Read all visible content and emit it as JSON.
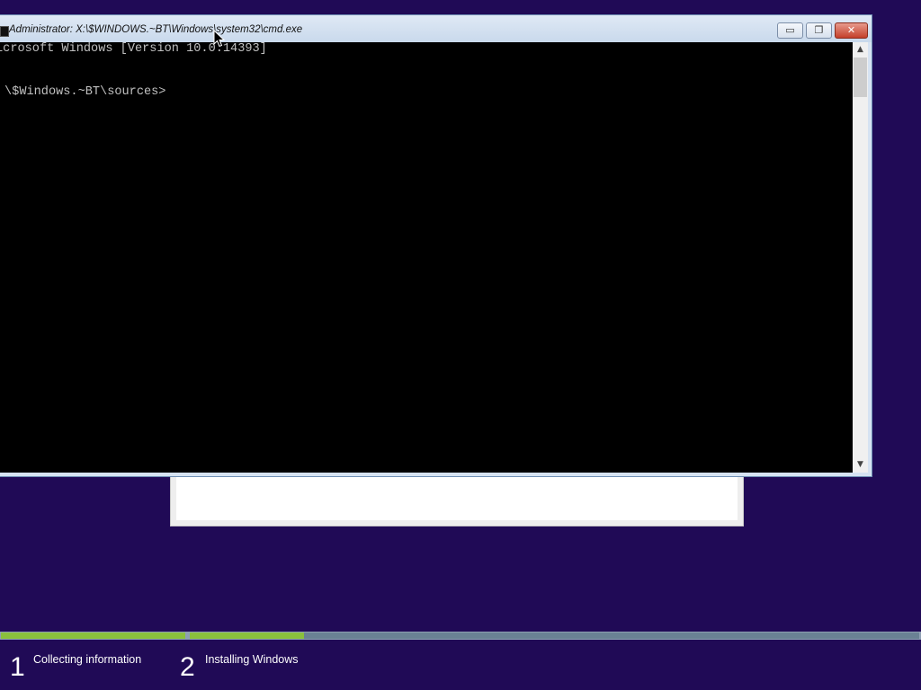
{
  "cmd_window": {
    "title": "Administrator: X:\\$WINDOWS.~BT\\Windows\\system32\\cmd.exe",
    "minimize_glyph": "▭",
    "maximize_glyph": "❐",
    "close_glyph": "✕",
    "console_lines": [
      "icrosoft Windows [Version 10.0.14393]",
      "\\$Windows.~BT\\sources>"
    ],
    "scroll_up_glyph": "▲",
    "scroll_down_glyph": "▼"
  },
  "setup_progress": {
    "steps": [
      {
        "number": "1",
        "label": "Collecting information",
        "progress": 1.0
      },
      {
        "number": "2",
        "label": "Installing Windows",
        "progress": 0.157
      }
    ]
  },
  "colors": {
    "desktop_background": "#200a56",
    "progress_fill": "#8ac03c",
    "progress_track": "#6a8194"
  },
  "icons": [
    "cmd-app-icon",
    "minimize-icon",
    "maximize-icon",
    "close-icon",
    "scroll-up-icon",
    "scroll-down-icon",
    "mouse-cursor-icon"
  ]
}
